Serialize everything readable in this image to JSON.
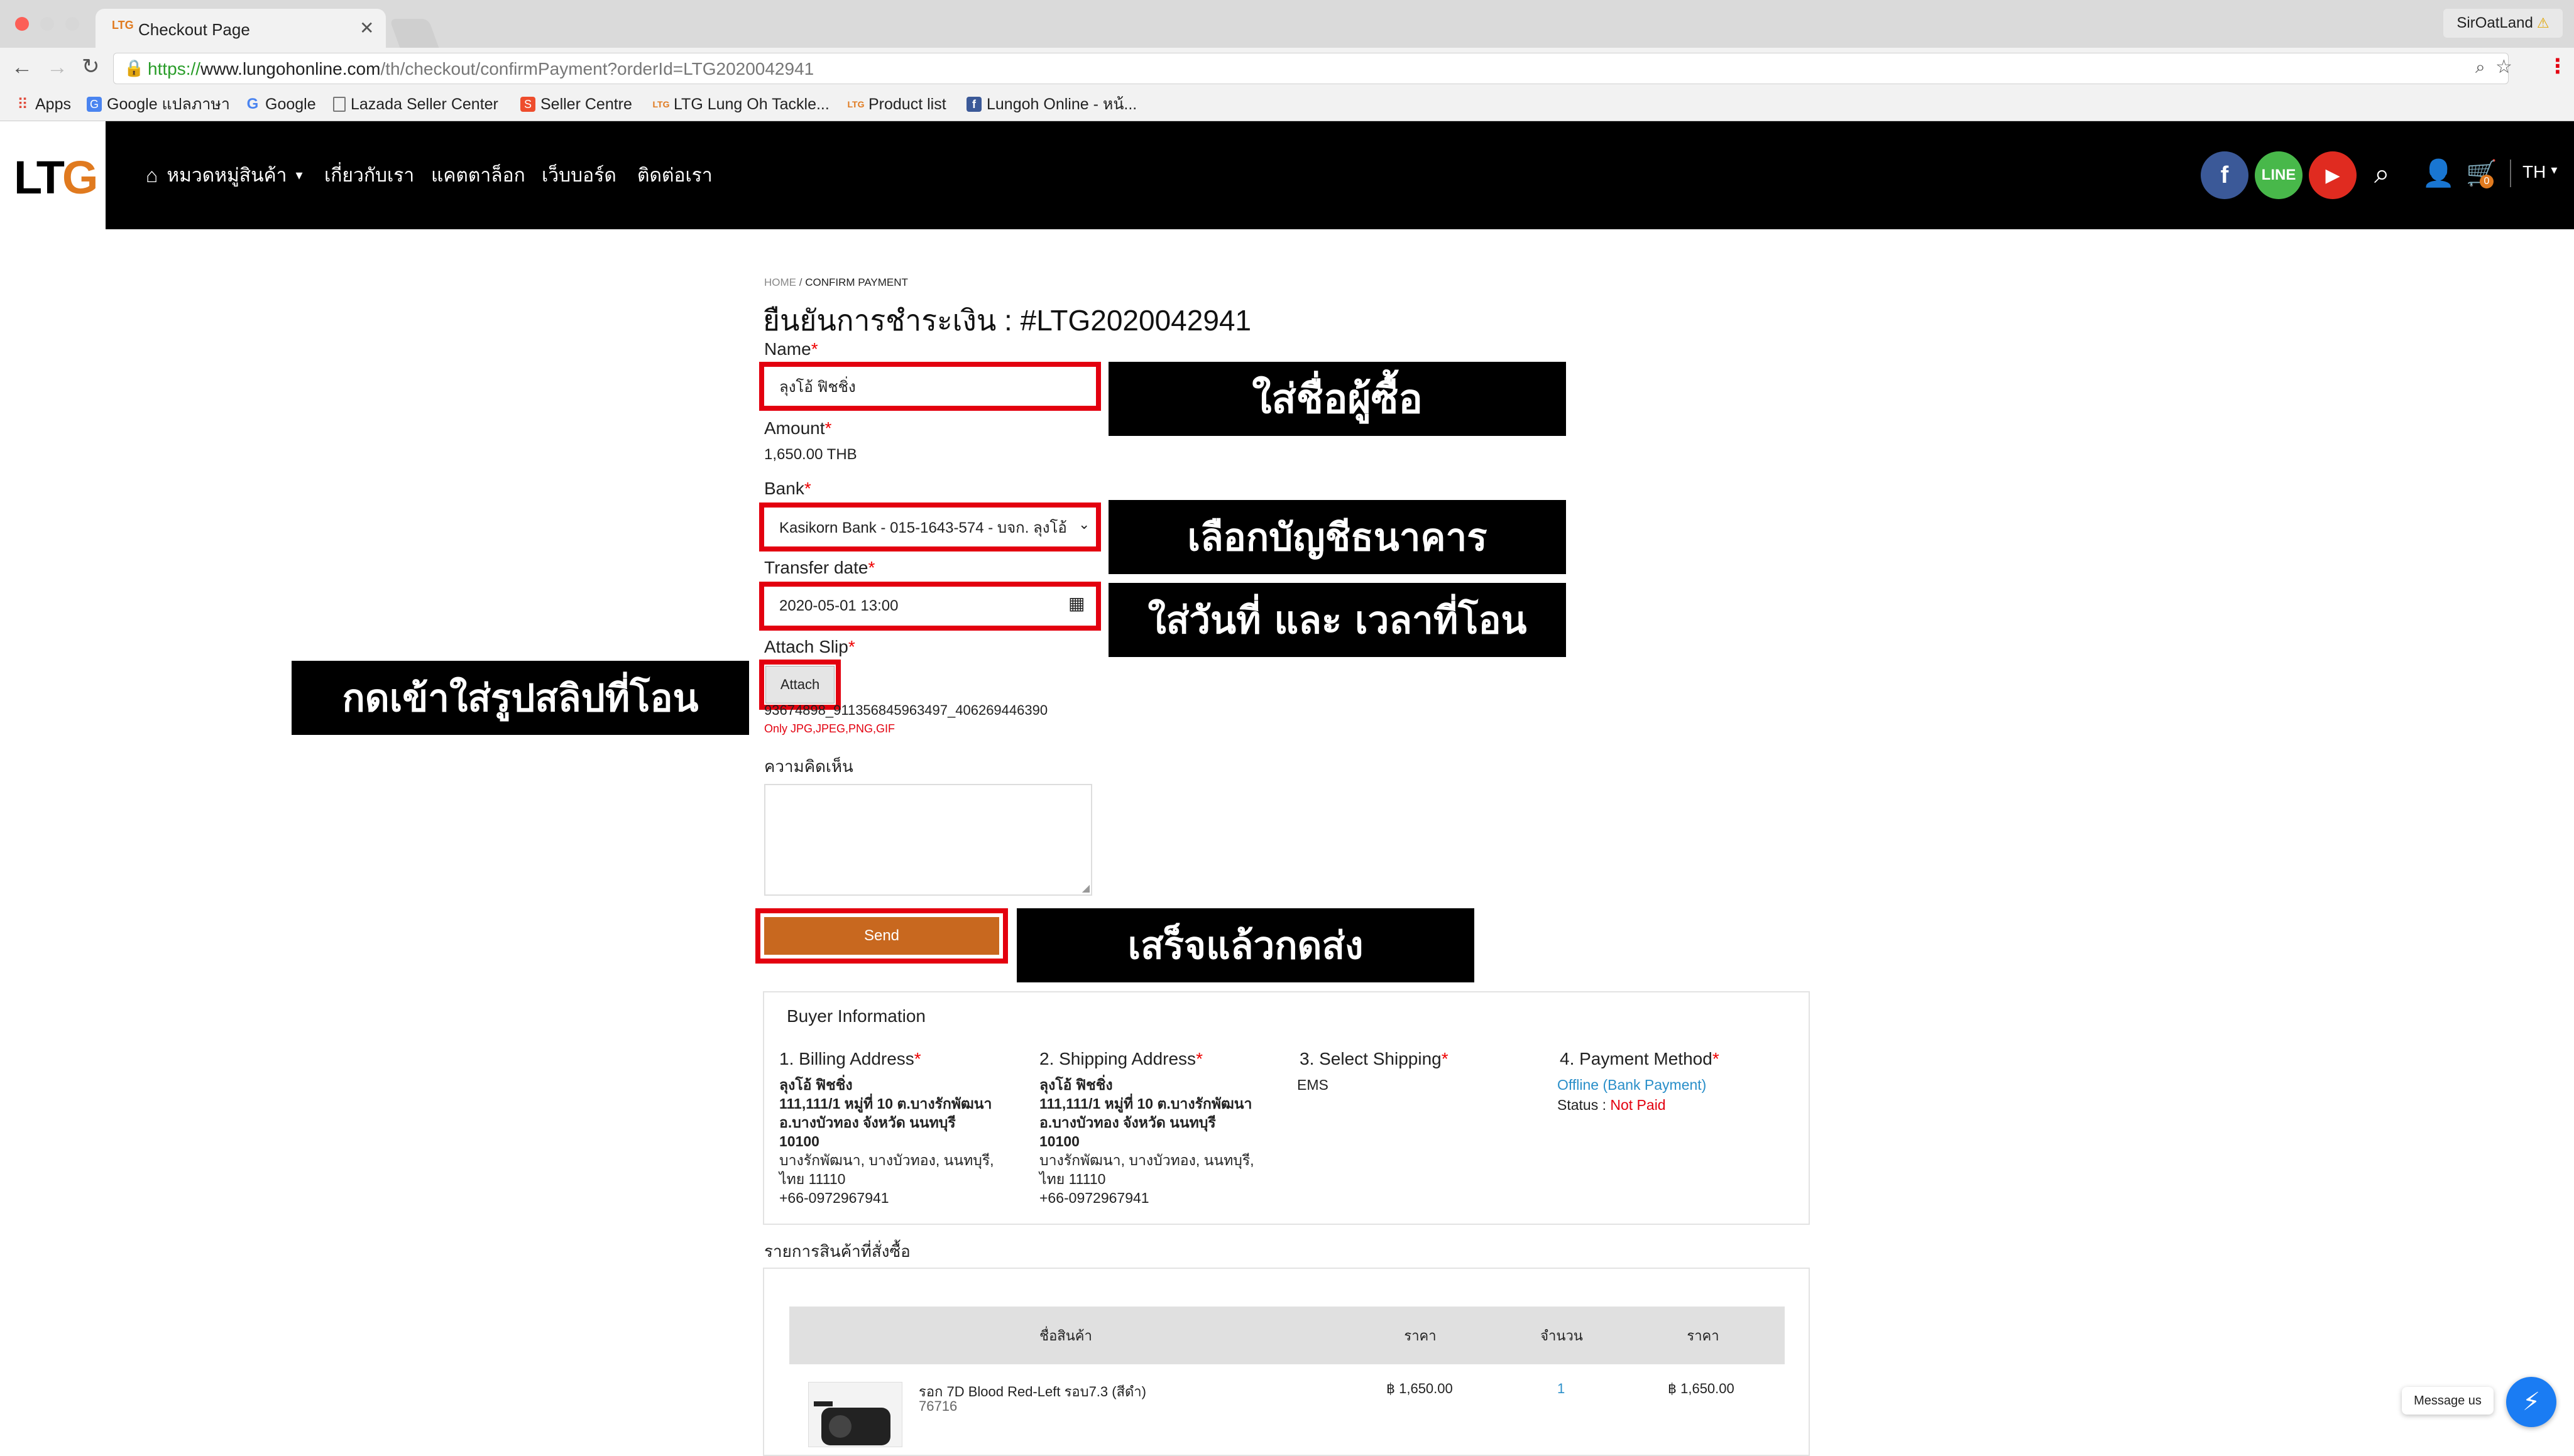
{
  "browser": {
    "tab_title": "Checkout Page",
    "tab_favicon": "ltg-favicon",
    "url_secure": "https://",
    "url_host": "www.lungohonline.com",
    "url_path": "/th/checkout/confirmPayment?orderId=LTG2020042941",
    "profile_name": "SirOatLand"
  },
  "bookmarks": [
    {
      "label": "Apps",
      "icon": "apps-grid-icon"
    },
    {
      "label": "Google แปลภาษา",
      "icon": "google-translate-icon"
    },
    {
      "label": "Google",
      "icon": "google-icon"
    },
    {
      "label": "Lazada Seller Center",
      "icon": "page-icon"
    },
    {
      "label": "Seller Centre",
      "icon": "shopee-icon"
    },
    {
      "label": "LTG Lung Oh Tackle...",
      "icon": "ltg-icon"
    },
    {
      "label": "Product list",
      "icon": "ltg-icon"
    },
    {
      "label": "Lungoh Online - หน้...",
      "icon": "facebook-icon"
    }
  ],
  "site": {
    "logo_text_1": "LT",
    "logo_text_2": "G",
    "nav": [
      "หมวดหมู่สินค้า",
      "เกี่ยวกับเรา",
      "แคตตาล็อก",
      "เว็บบอร์ด",
      "ติดต่อเรา"
    ],
    "language": "TH",
    "cart_count": "0"
  },
  "breadcrumb": {
    "home": "HOME",
    "sep": "/",
    "current": "CONFIRM PAYMENT"
  },
  "page_title": "ยืนยันการชำระเงิน : #LTG2020042941",
  "form": {
    "name_label": "Name",
    "name_value": "ลุงโอ้ ฟิชชิ่ง",
    "amount_label": "Amount",
    "amount_value": "1,650.00 THB",
    "bank_label": "Bank",
    "bank_value": "Kasikorn Bank - 015-1643-574 - บจก. ลุงโอ้",
    "date_label": "Transfer date",
    "date_value": "2020-05-01 13:00",
    "slip_label": "Attach Slip",
    "attach_button": "Attach",
    "file_name": "93674898_911356845963497_406269446390",
    "file_hint": "Only JPG,JPEG,PNG,GIF",
    "comment_label": "ความคิดเห็น",
    "send_button": "Send",
    "required_mark": "*"
  },
  "callouts": {
    "name": "ใส่ชื่อผู้ซื้อ",
    "bank": "เลือกบัญชีธนาคาร",
    "date": "ใส่วันที่ และ เวลาที่โอน",
    "slip": "กดเข้าใส่รูปสลิปที่โอน",
    "send": "เสร็จแล้วกดส่ง"
  },
  "buyer_info": {
    "title": "Buyer Information",
    "billing_title": "1. Billing Address",
    "billing_name": "ลุงโอ้ ฟิชชิ่ง",
    "billing_bold": "111,111/1 หมู่ที่ 10 ต.บางรักพัฒนา\nอ.บางบัวทอง จังหวัด นนทบุรี\n10100",
    "billing_rest": "บางรักพัฒนา, บางบัวทอง, นนทบุรี,\nไทย 11110\n+66-0972967941",
    "shipping_title": "2. Shipping Address",
    "shipping_name": "ลุงโอ้ ฟิชชิ่ง",
    "shipping_bold": "111,111/1 หมู่ที่ 10 ต.บางรักพัฒนา\nอ.บางบัวทอง จังหวัด นนทบุรี\n10100",
    "shipping_rest": "บางรักพัฒนา, บางบัวทอง, นนทบุรี,\nไทย 11110\n+66-0972967941",
    "select_shipping_title": "3. Select Shipping",
    "shipping_method": "EMS",
    "payment_title": "4. Payment Method",
    "payment_method": "Offline (Bank Payment)",
    "status_label": "Status : ",
    "status_value": "Not Paid"
  },
  "order_items": {
    "title": "รายการสินค้าที่สั่งซื้อ",
    "headers": [
      "ชื่อสินค้า",
      "ราคา",
      "จำนวน",
      "ราคา"
    ],
    "rows": [
      {
        "name": "รอก 7D Blood Red-Left รอบ7.3 (สีดำ)",
        "code": "76716",
        "price": "฿ 1,650.00",
        "qty": "1",
        "total": "฿ 1,650.00"
      }
    ]
  },
  "messenger": {
    "label": "Message us"
  },
  "colors": {
    "accent_red": "#e3000f",
    "send_button": "#c8681f",
    "link_blue": "#2a8fc9",
    "brand_orange": "#e07a1f"
  }
}
